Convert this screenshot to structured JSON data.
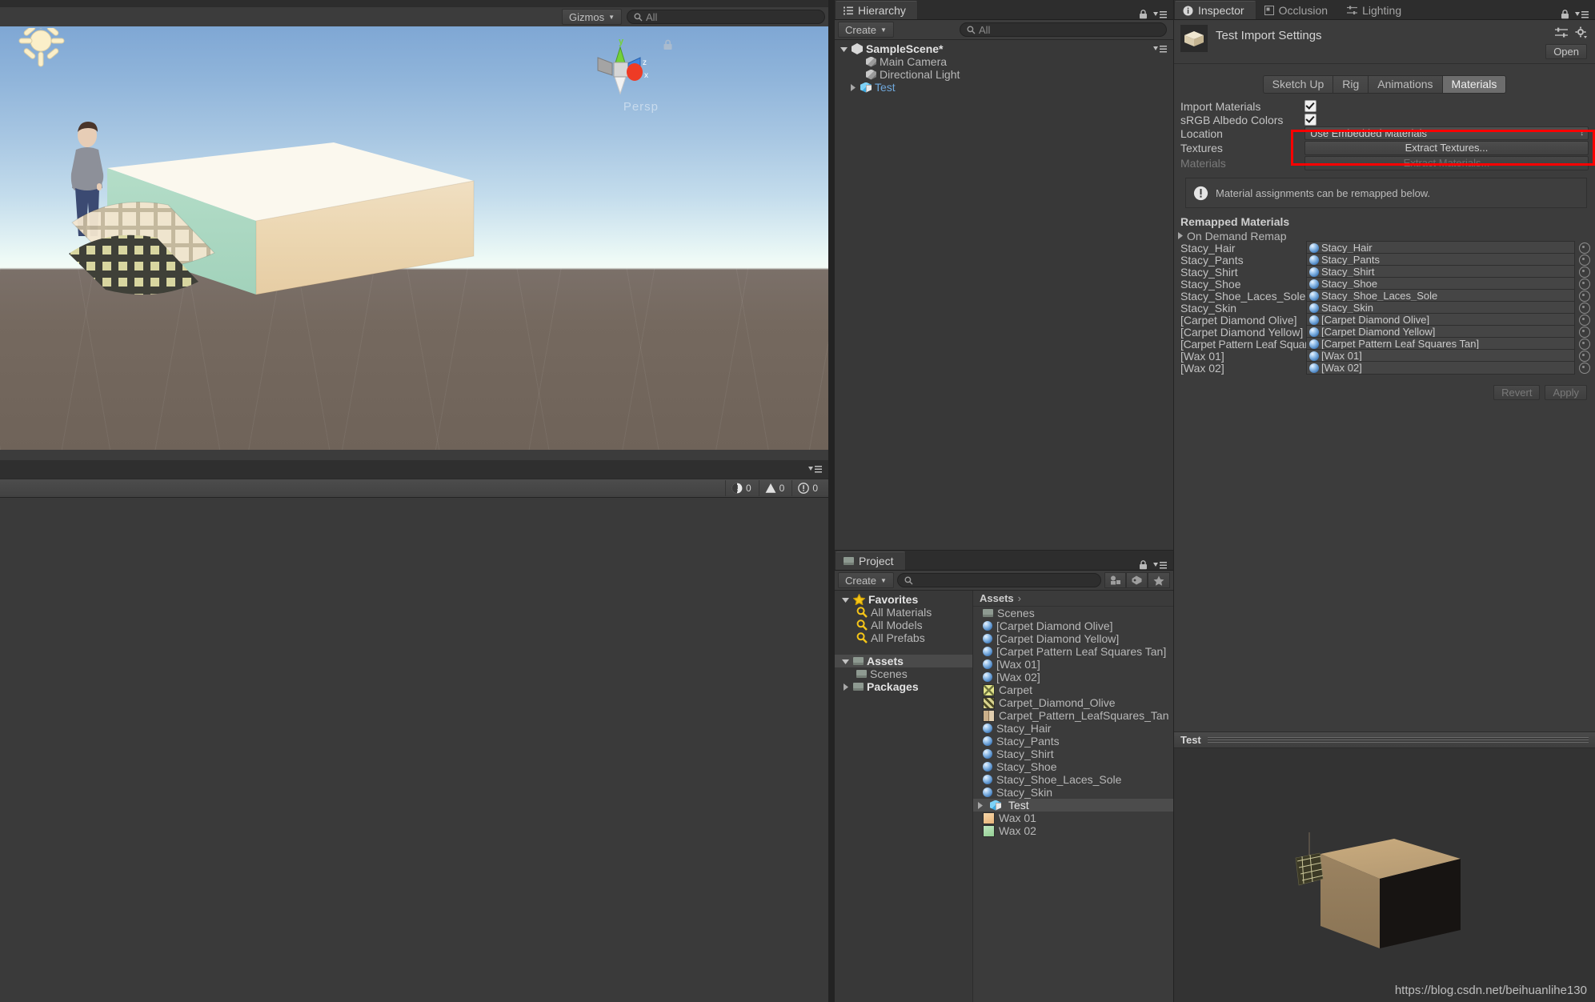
{
  "scene_view": {
    "toolbar": {
      "gizmos_label": "Gizmos",
      "search_placeholder": "All"
    },
    "persp_label": "Persp",
    "gizmo_axes": {
      "y": "y",
      "x": "x",
      "z": "z"
    }
  },
  "console": {
    "errors": "0",
    "warnings": "0",
    "infos": "0"
  },
  "hierarchy": {
    "tab_label": "Hierarchy",
    "create_label": "Create",
    "search_placeholder": "All",
    "scene_name": "SampleScene*",
    "items": [
      {
        "label": "Main Camera",
        "icon": "cube-icon",
        "selected": false,
        "expandable": false
      },
      {
        "label": "Directional Light",
        "icon": "cube-icon",
        "selected": false,
        "expandable": false
      },
      {
        "label": "Test",
        "icon": "prefab-icon",
        "selected": true,
        "expandable": true
      }
    ]
  },
  "project": {
    "tab_label": "Project",
    "create_label": "Create",
    "search_placeholder": "",
    "favorites_label": "Favorites",
    "favorites": [
      {
        "label": "All Materials"
      },
      {
        "label": "All Models"
      },
      {
        "label": "All Prefabs"
      }
    ],
    "tree": [
      {
        "label": "Assets",
        "selected": true,
        "expanded": true,
        "depth": 0
      },
      {
        "label": "Scenes",
        "selected": false,
        "expanded": false,
        "depth": 1
      },
      {
        "label": "Packages",
        "selected": false,
        "expanded": false,
        "depth": 0
      }
    ],
    "breadcrumb": "Assets",
    "assets": [
      {
        "label": "Scenes",
        "icon": "folder-icon",
        "selected": false
      },
      {
        "label": "[Carpet Diamond Olive]",
        "icon": "material-icon",
        "selected": false
      },
      {
        "label": "[Carpet Diamond Yellow]",
        "icon": "material-icon",
        "selected": false
      },
      {
        "label": "[Carpet Pattern Leaf Squares Tan]",
        "icon": "material-icon",
        "selected": false
      },
      {
        "label": "[Wax 01]",
        "icon": "material-icon",
        "selected": false
      },
      {
        "label": "[Wax 02]",
        "icon": "material-icon",
        "selected": false
      },
      {
        "label": "Carpet",
        "icon": "texture-icon",
        "selected": false,
        "swatch": "#e3e58a"
      },
      {
        "label": "Carpet_Diamond_Olive",
        "icon": "texture-icon",
        "selected": false,
        "swatch": "#6a6230"
      },
      {
        "label": "Carpet_Pattern_LeafSquares_Tan",
        "icon": "texture-icon",
        "selected": false,
        "swatch": "#b9a183"
      },
      {
        "label": "Stacy_Hair",
        "icon": "material-icon",
        "selected": false
      },
      {
        "label": "Stacy_Pants",
        "icon": "material-icon",
        "selected": false
      },
      {
        "label": "Stacy_Shirt",
        "icon": "material-icon",
        "selected": false
      },
      {
        "label": "Stacy_Shoe",
        "icon": "material-icon",
        "selected": false
      },
      {
        "label": "Stacy_Shoe_Laces_Sole",
        "icon": "material-icon",
        "selected": false
      },
      {
        "label": "Stacy_Skin",
        "icon": "material-icon",
        "selected": false
      },
      {
        "label": "Test",
        "icon": "prefab-icon",
        "selected": true
      },
      {
        "label": "Wax 01",
        "icon": "texture-icon",
        "selected": false,
        "swatch": "#f2c894"
      },
      {
        "label": "Wax 02",
        "icon": "texture-icon",
        "selected": false,
        "swatch": "#a9dba9"
      }
    ]
  },
  "inspector": {
    "tabs": [
      {
        "label": "Inspector",
        "active": true,
        "icon": "info-icon"
      },
      {
        "label": "Occlusion",
        "active": false,
        "icon": "occlusion-icon"
      },
      {
        "label": "Lighting",
        "active": false,
        "icon": "lighting-icon"
      }
    ],
    "title": "Test Import Settings",
    "open_button": "Open",
    "import_tabs": [
      {
        "label": "Sketch Up",
        "active": false
      },
      {
        "label": "Rig",
        "active": false
      },
      {
        "label": "Animations",
        "active": false
      },
      {
        "label": "Materials",
        "active": true
      }
    ],
    "properties": [
      {
        "label": "Import Materials",
        "type": "checkbox",
        "value": true
      },
      {
        "label": "sRGB Albedo Colors",
        "type": "checkbox",
        "value": true
      },
      {
        "label": "Location",
        "type": "dropdown",
        "value": "Use Embedded Materials"
      },
      {
        "label": "Textures",
        "type": "button",
        "value": "Extract Textures...",
        "disabled": false
      },
      {
        "label": "Materials",
        "type": "button",
        "value": "Extract Materials...",
        "disabled": true
      }
    ],
    "help_text": "Material assignments can be remapped below.",
    "remapped_title": "Remapped Materials",
    "on_demand_remap": "On Demand Remap",
    "remap_rows": [
      {
        "name": "Stacy_Hair",
        "value": "Stacy_Hair"
      },
      {
        "name": "Stacy_Pants",
        "value": "Stacy_Pants"
      },
      {
        "name": "Stacy_Shirt",
        "value": "Stacy_Shirt"
      },
      {
        "name": "Stacy_Shoe",
        "value": "Stacy_Shoe"
      },
      {
        "name": "Stacy_Shoe_Laces_Sole",
        "value": "Stacy_Shoe_Laces_Sole"
      },
      {
        "name": "Stacy_Skin",
        "value": "Stacy_Skin"
      },
      {
        "name": "[Carpet Diamond Olive]",
        "value": "[Carpet Diamond Olive]"
      },
      {
        "name": "[Carpet Diamond Yellow]",
        "value": "[Carpet Diamond Yellow]"
      },
      {
        "name": "[Carpet Pattern Leaf Squares Tan]",
        "value": "[Carpet Pattern Leaf Squares Tan]"
      },
      {
        "name": "[Wax 01]",
        "value": "[Wax 01]"
      },
      {
        "name": "[Wax 02]",
        "value": "[Wax 02]"
      }
    ],
    "revert_label": "Revert",
    "apply_label": "Apply",
    "highlight_color": "#ff0000"
  },
  "preview": {
    "title": "Test",
    "watermark": "https://blog.csdn.net/beihuanlihe130"
  }
}
